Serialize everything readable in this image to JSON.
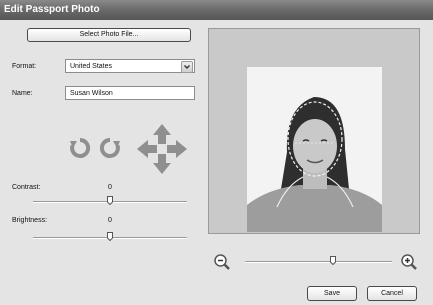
{
  "window": {
    "title": "Edit Passport Photo"
  },
  "select_photo_button": "Select Photo File...",
  "format": {
    "label": "Format:",
    "value": "United States"
  },
  "name": {
    "label": "Name:",
    "value": "Susan Wilson"
  },
  "contrast": {
    "label": "Contrast:",
    "value": "0",
    "level": 0.5
  },
  "brightness": {
    "label": "Brightness:",
    "value": "0",
    "level": 0.5
  },
  "zoom": {
    "level": 0.6
  },
  "buttons": {
    "save": "Save",
    "cancel": "Cancel"
  },
  "colors": {
    "title_bar": "#666666",
    "window_bg": "#e4e4e4",
    "preview_bg": "#c9c9c9"
  },
  "icons": [
    "rotate-left-icon",
    "rotate-right-icon",
    "move-arrows-icon",
    "zoom-out-icon",
    "zoom-in-icon",
    "chevron-down-icon"
  ]
}
